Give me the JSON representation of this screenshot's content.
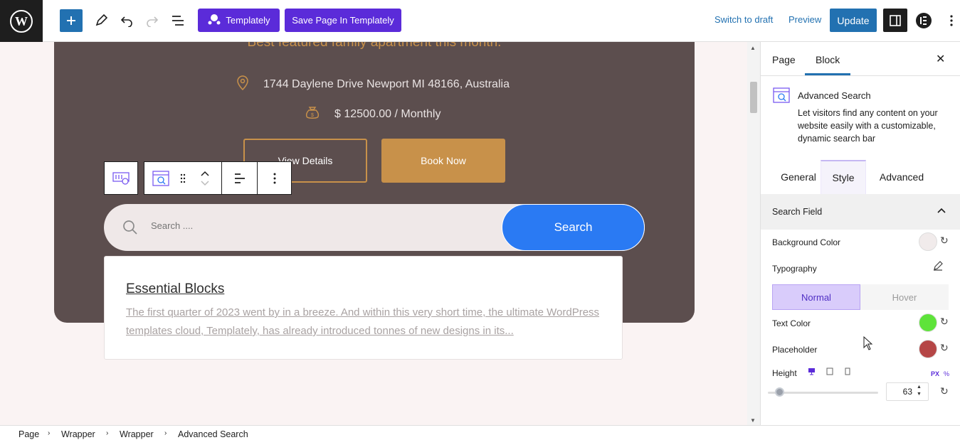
{
  "topbar": {
    "templately_label": "Templately",
    "save_templately_label": "Save Page In Templately",
    "switch_draft_label": "Switch to draft",
    "preview_label": "Preview",
    "update_label": "Update"
  },
  "canvas": {
    "hero_subtitle": "Best featured family apartment this month.",
    "address": "1744 Daylene Drive Newport MI 48166, Australia",
    "price": "$ 12500.00 / Monthly",
    "view_details_label": "View Details",
    "book_now_label": "Book Now",
    "search": {
      "placeholder": "Search ....",
      "button_label": "Search"
    },
    "result": {
      "title": "Essential Blocks",
      "description": "The first quarter of 2023 went by in a breeze. And within this very short time, the ultimate WordPress templates cloud, Templately, has already introduced tonnes of new designs in its..."
    }
  },
  "panel": {
    "tabs": [
      "Page",
      "Block"
    ],
    "active_tab": "Block",
    "block_name": "Advanced Search",
    "block_desc": "Let visitors find any content on your website easily with a customizable, dynamic search bar",
    "style_tabs": [
      "General",
      "Style",
      "Advanced"
    ],
    "active_style_tab": "Style",
    "section_title": "Search Field",
    "background_color_label": "Background Color",
    "background_color": "#f1ebeb",
    "typography_label": "Typography",
    "normal_label": "Normal",
    "hover_label": "Hover",
    "text_color_label": "Text Color",
    "text_color": "#5ee33a",
    "placeholder_label": "Placeholder",
    "placeholder_color": "#b54646",
    "height_label": "Height",
    "height_value": "63",
    "unit_px": "PX",
    "unit_pct": "%"
  },
  "breadcrumb": [
    "Page",
    "Wrapper",
    "Wrapper",
    "Advanced Search"
  ],
  "colors": {
    "accent": "#2271b1",
    "templately": "#5b2bd9",
    "hero_bg": "#5c4e4e",
    "gold": "#c8914a",
    "search_button": "#2a7af3"
  }
}
